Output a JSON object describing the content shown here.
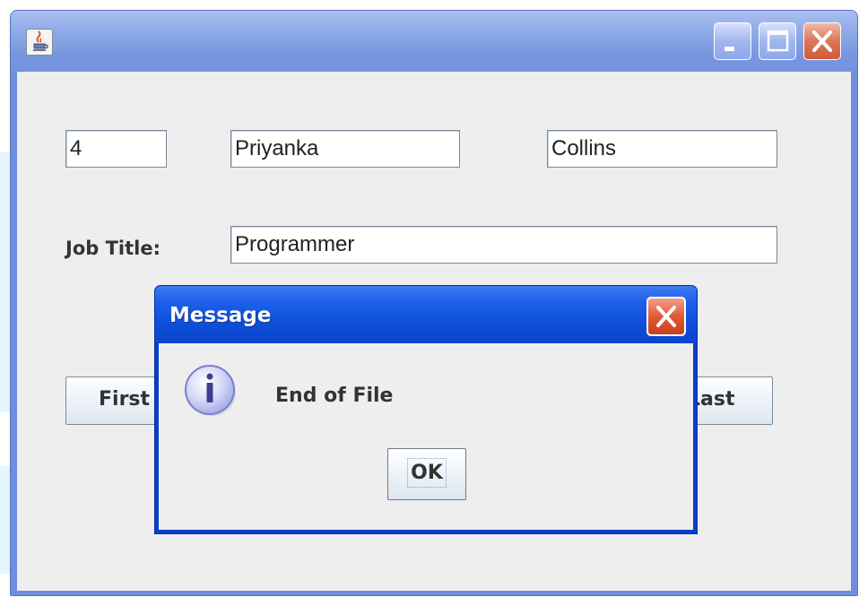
{
  "window": {
    "title": "",
    "icon": "java-cup-icon",
    "controls": [
      "minimize-icon",
      "maximize-icon",
      "close-icon"
    ]
  },
  "form": {
    "id_value": "4",
    "first_name_value": "Priyanka",
    "last_name_value": "Collins",
    "job_title_label": "Job Title:",
    "job_title_value": "Programmer",
    "first_button": "First",
    "last_button": "Last"
  },
  "dialog": {
    "title": "Message",
    "icon": "info-icon",
    "message": "End of File",
    "ok_label": "OK"
  },
  "colors": {
    "window_frame": "#7592de",
    "dialog_title": "#0a45cc",
    "content_bg": "#eeeeee"
  }
}
